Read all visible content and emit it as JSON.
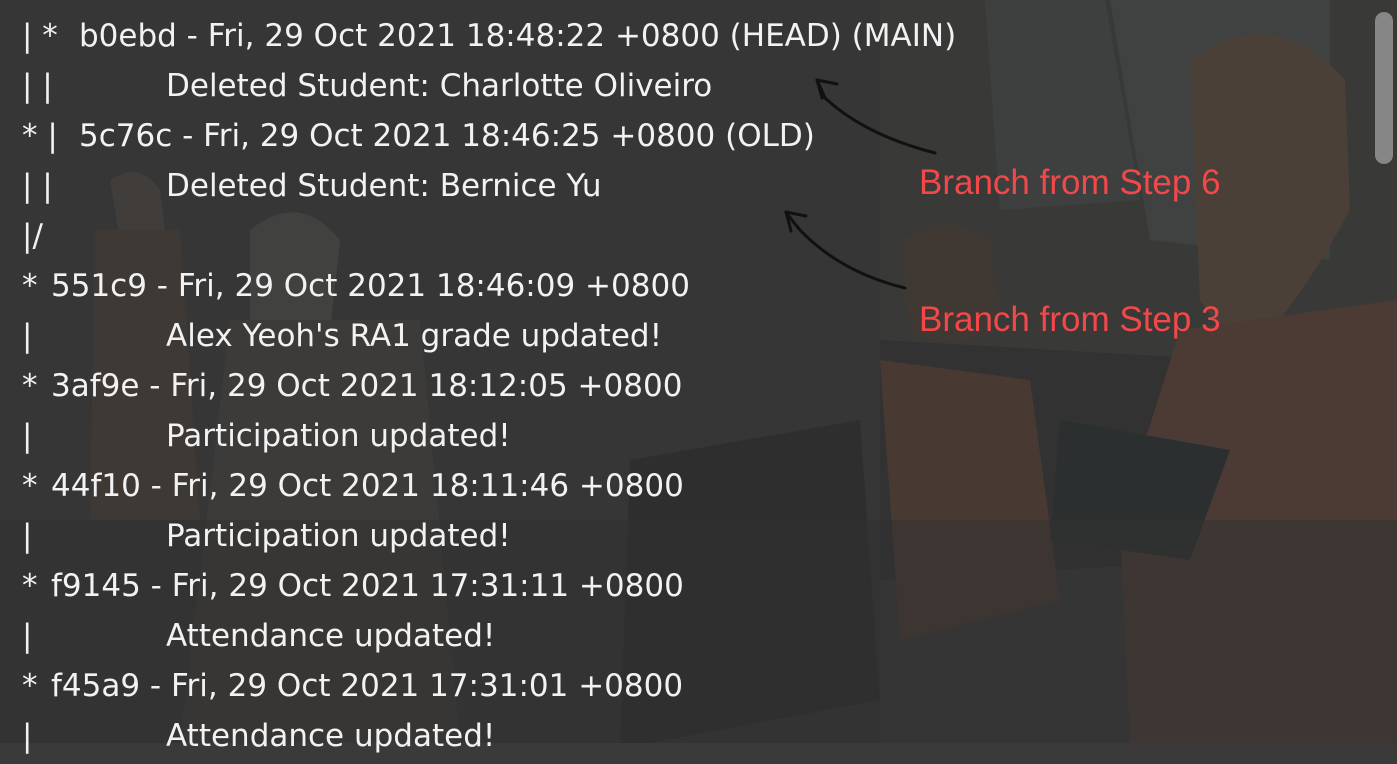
{
  "log": {
    "lines": [
      {
        "graph": "| *",
        "text": "b0ebd - Fri, 29 Oct 2021 18:48:22 +0800 (HEAD) (MAIN)",
        "kind": "commit"
      },
      {
        "graph": "| |",
        "text": "Deleted Student: Charlotte Oliveiro",
        "kind": "message"
      },
      {
        "graph": "* |",
        "text": "5c76c - Fri, 29 Oct 2021 18:46:25 +0800 (OLD)",
        "kind": "commit"
      },
      {
        "graph": "| |",
        "text": "Deleted Student: Bernice Yu",
        "kind": "message"
      },
      {
        "graph": "|/",
        "text": "",
        "kind": "graph"
      },
      {
        "graph": "*",
        "text": "551c9 - Fri, 29 Oct 2021 18:46:09 +0800",
        "kind": "commit"
      },
      {
        "graph": "|",
        "text": "Alex Yeoh's RA1 grade updated!",
        "kind": "message"
      },
      {
        "graph": "*",
        "text": "3af9e - Fri, 29 Oct 2021 18:12:05 +0800",
        "kind": "commit"
      },
      {
        "graph": "|",
        "text": "Participation updated!",
        "kind": "message"
      },
      {
        "graph": "*",
        "text": "44f10 - Fri, 29 Oct 2021 18:11:46 +0800",
        "kind": "commit"
      },
      {
        "graph": "|",
        "text": "Participation updated!",
        "kind": "message"
      },
      {
        "graph": "*",
        "text": "f9145 - Fri, 29 Oct 2021 17:31:11 +0800",
        "kind": "commit"
      },
      {
        "graph": "|",
        "text": "Attendance updated!",
        "kind": "message"
      },
      {
        "graph": "*",
        "text": "f45a9 - Fri, 29 Oct 2021 17:31:01 +0800",
        "kind": "commit"
      },
      {
        "graph": "|",
        "text": "Attendance updated!",
        "kind": "message"
      }
    ]
  },
  "annotations": {
    "step6": "Branch from Step 6",
    "step3": "Branch from Step 3"
  },
  "colors": {
    "text": "#f2f2f2",
    "annotation": "#f2484a",
    "background": "#3a3a3a"
  }
}
